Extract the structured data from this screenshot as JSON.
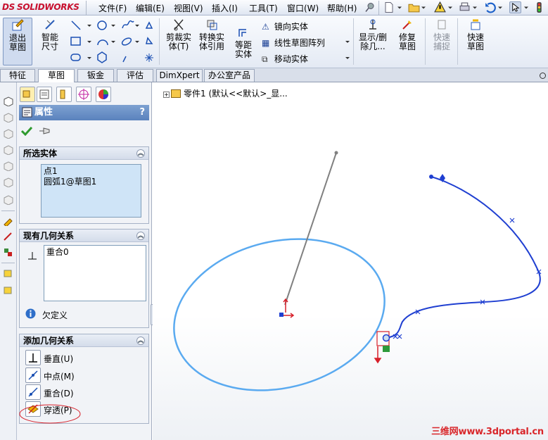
{
  "app": {
    "logo_text": "SOLIDWORKS",
    "logo_prefix": "DS"
  },
  "menu": {
    "items": [
      "文件(F)",
      "编辑(E)",
      "视图(V)",
      "插入(I)",
      "工具(T)",
      "窗口(W)",
      "帮助(H)"
    ]
  },
  "commands": {
    "exit_sketch": "退出草图",
    "smart_dimension": "智能尺寸",
    "trim": "剪裁实体(T)",
    "convert": "转换实体引用",
    "offset": "等距实体",
    "mirror": "镜向实体",
    "linear_pattern": "线性草图阵列",
    "move": "移动实体",
    "display_delete": "显示/删除几...",
    "repair": "修复草图",
    "quick_snap": "快速捕捉",
    "rapid_sketch": "快速草图"
  },
  "tabs": [
    "特征",
    "草图",
    "钣金",
    "评估",
    "DimXpert",
    "办公室产品"
  ],
  "active_tab": "草图",
  "property_manager": {
    "title": "属性",
    "help": "?",
    "selected_group": {
      "title": "所选实体",
      "items": [
        "点1",
        "圆弧1@草图1"
      ]
    },
    "existing_group": {
      "title": "现有几何关系",
      "items": [
        "重合0"
      ],
      "status": "欠定义"
    },
    "add_group": {
      "title": "添加几何关系",
      "relations": [
        "垂直(U)",
        "中点(M)",
        "重合(D)",
        "穿透(P)"
      ]
    }
  },
  "tree": {
    "root_label": "零件1  (默认<<默认>_显..."
  },
  "watermark": "三维网www.3dportal.cn",
  "colors": {
    "accent": "#5a82bd",
    "sketch_blue": "#1f3fd1",
    "ellipse_blue": "#5aaaf0",
    "highlight": "#d7202a"
  }
}
